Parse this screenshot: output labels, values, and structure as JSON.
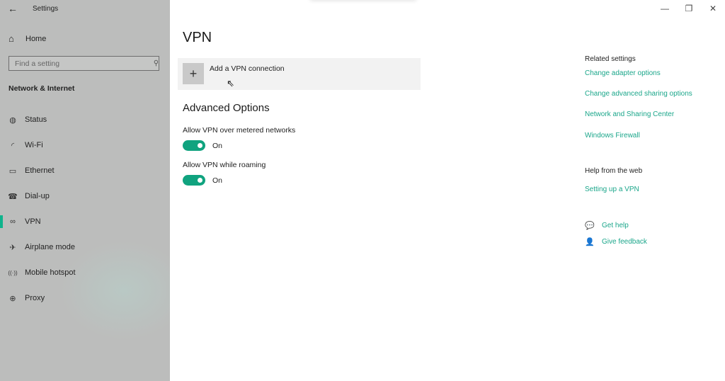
{
  "window": {
    "title": "Settings",
    "controls": {
      "minimize": "—",
      "restore": "❐",
      "close": "✕"
    }
  },
  "sidebar": {
    "back_icon": "←",
    "home": {
      "icon": "⌂",
      "label": "Home"
    },
    "search": {
      "placeholder": "Find a setting",
      "value": "",
      "icon": "⚲"
    },
    "section_title": "Network & Internet",
    "items": [
      {
        "icon": "◍",
        "label": "Status",
        "selected": false
      },
      {
        "icon": "◜",
        "label": "Wi-Fi",
        "selected": false
      },
      {
        "icon": "▭",
        "label": "Ethernet",
        "selected": false
      },
      {
        "icon": "☎",
        "label": "Dial-up",
        "selected": false
      },
      {
        "icon": "∞",
        "label": "VPN",
        "selected": true
      },
      {
        "icon": "✈",
        "label": "Airplane mode",
        "selected": false
      },
      {
        "icon": "((·))",
        "label": "Mobile hotspot",
        "selected": false
      },
      {
        "icon": "⊕",
        "label": "Proxy",
        "selected": false
      }
    ]
  },
  "main": {
    "title": "VPN",
    "add_vpn": {
      "icon": "+",
      "label": "Add a VPN connection"
    },
    "cursor_icon": "⇖",
    "advanced_title": "Advanced Options",
    "options": [
      {
        "label": "Allow VPN over metered networks",
        "state": "On",
        "enabled": true
      },
      {
        "label": "Allow VPN while roaming",
        "state": "On",
        "enabled": true
      }
    ]
  },
  "related": {
    "heading": "Related settings",
    "links": [
      "Change adapter options",
      "Change advanced sharing options",
      "Network and Sharing Center",
      "Windows Firewall"
    ],
    "help_heading": "Help from the web",
    "help_links": [
      "Setting up a VPN"
    ],
    "actions": [
      {
        "icon": "💬",
        "label": "Get help"
      },
      {
        "icon": "👤",
        "label": "Give feedback"
      }
    ]
  },
  "colors": {
    "accent": "#10a37f",
    "link": "#1aa68a",
    "sidebar_bg": "#bcbdbc"
  }
}
